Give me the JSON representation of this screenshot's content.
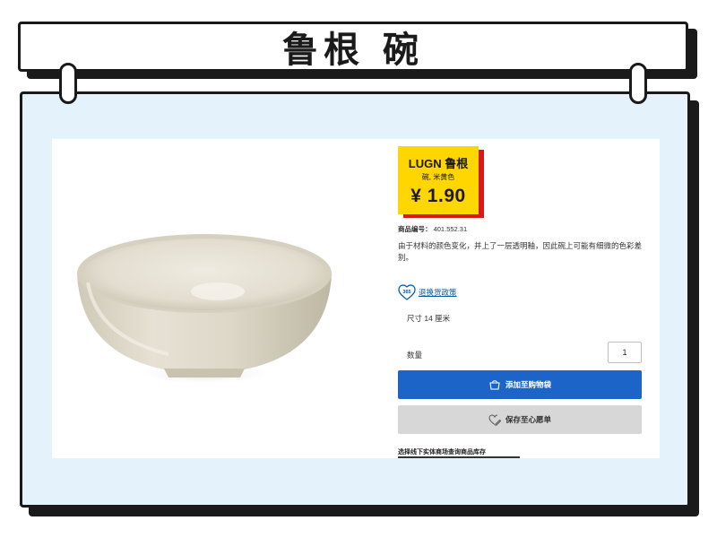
{
  "banner": {
    "title": "鲁根 碗"
  },
  "product": {
    "name": "LUGN 鲁根",
    "subtitle": "碗, 米黄色",
    "price": "¥ 1.90",
    "article_label": "商品编号：",
    "article_number": "401.552.31",
    "description": "由于材料的颜色变化，并上了一层透明釉，因此碗上可能有细微的色彩差别。",
    "guarantee_badge": "365",
    "guarantee_link": "退换货政策",
    "size": "尺寸 14 厘米",
    "quantity_label": "数量",
    "quantity_value": "1",
    "add_to_cart": "添加至购物袋",
    "save_to_list": "保存至心愿单",
    "store_stock_label": "选择线下实体商场查询商品库存"
  },
  "colors": {
    "frame_bg": "#e3f2fb",
    "price_tag": "#ffd600",
    "price_tag_accent": "#d9181b",
    "primary_button": "#1d64c8",
    "secondary_button": "#d7d7d7",
    "link": "#0058a3"
  },
  "icons": {
    "cart": "shopping-bag-icon",
    "wishlist": "heart-edit-icon",
    "guarantee": "heart-365-icon"
  }
}
